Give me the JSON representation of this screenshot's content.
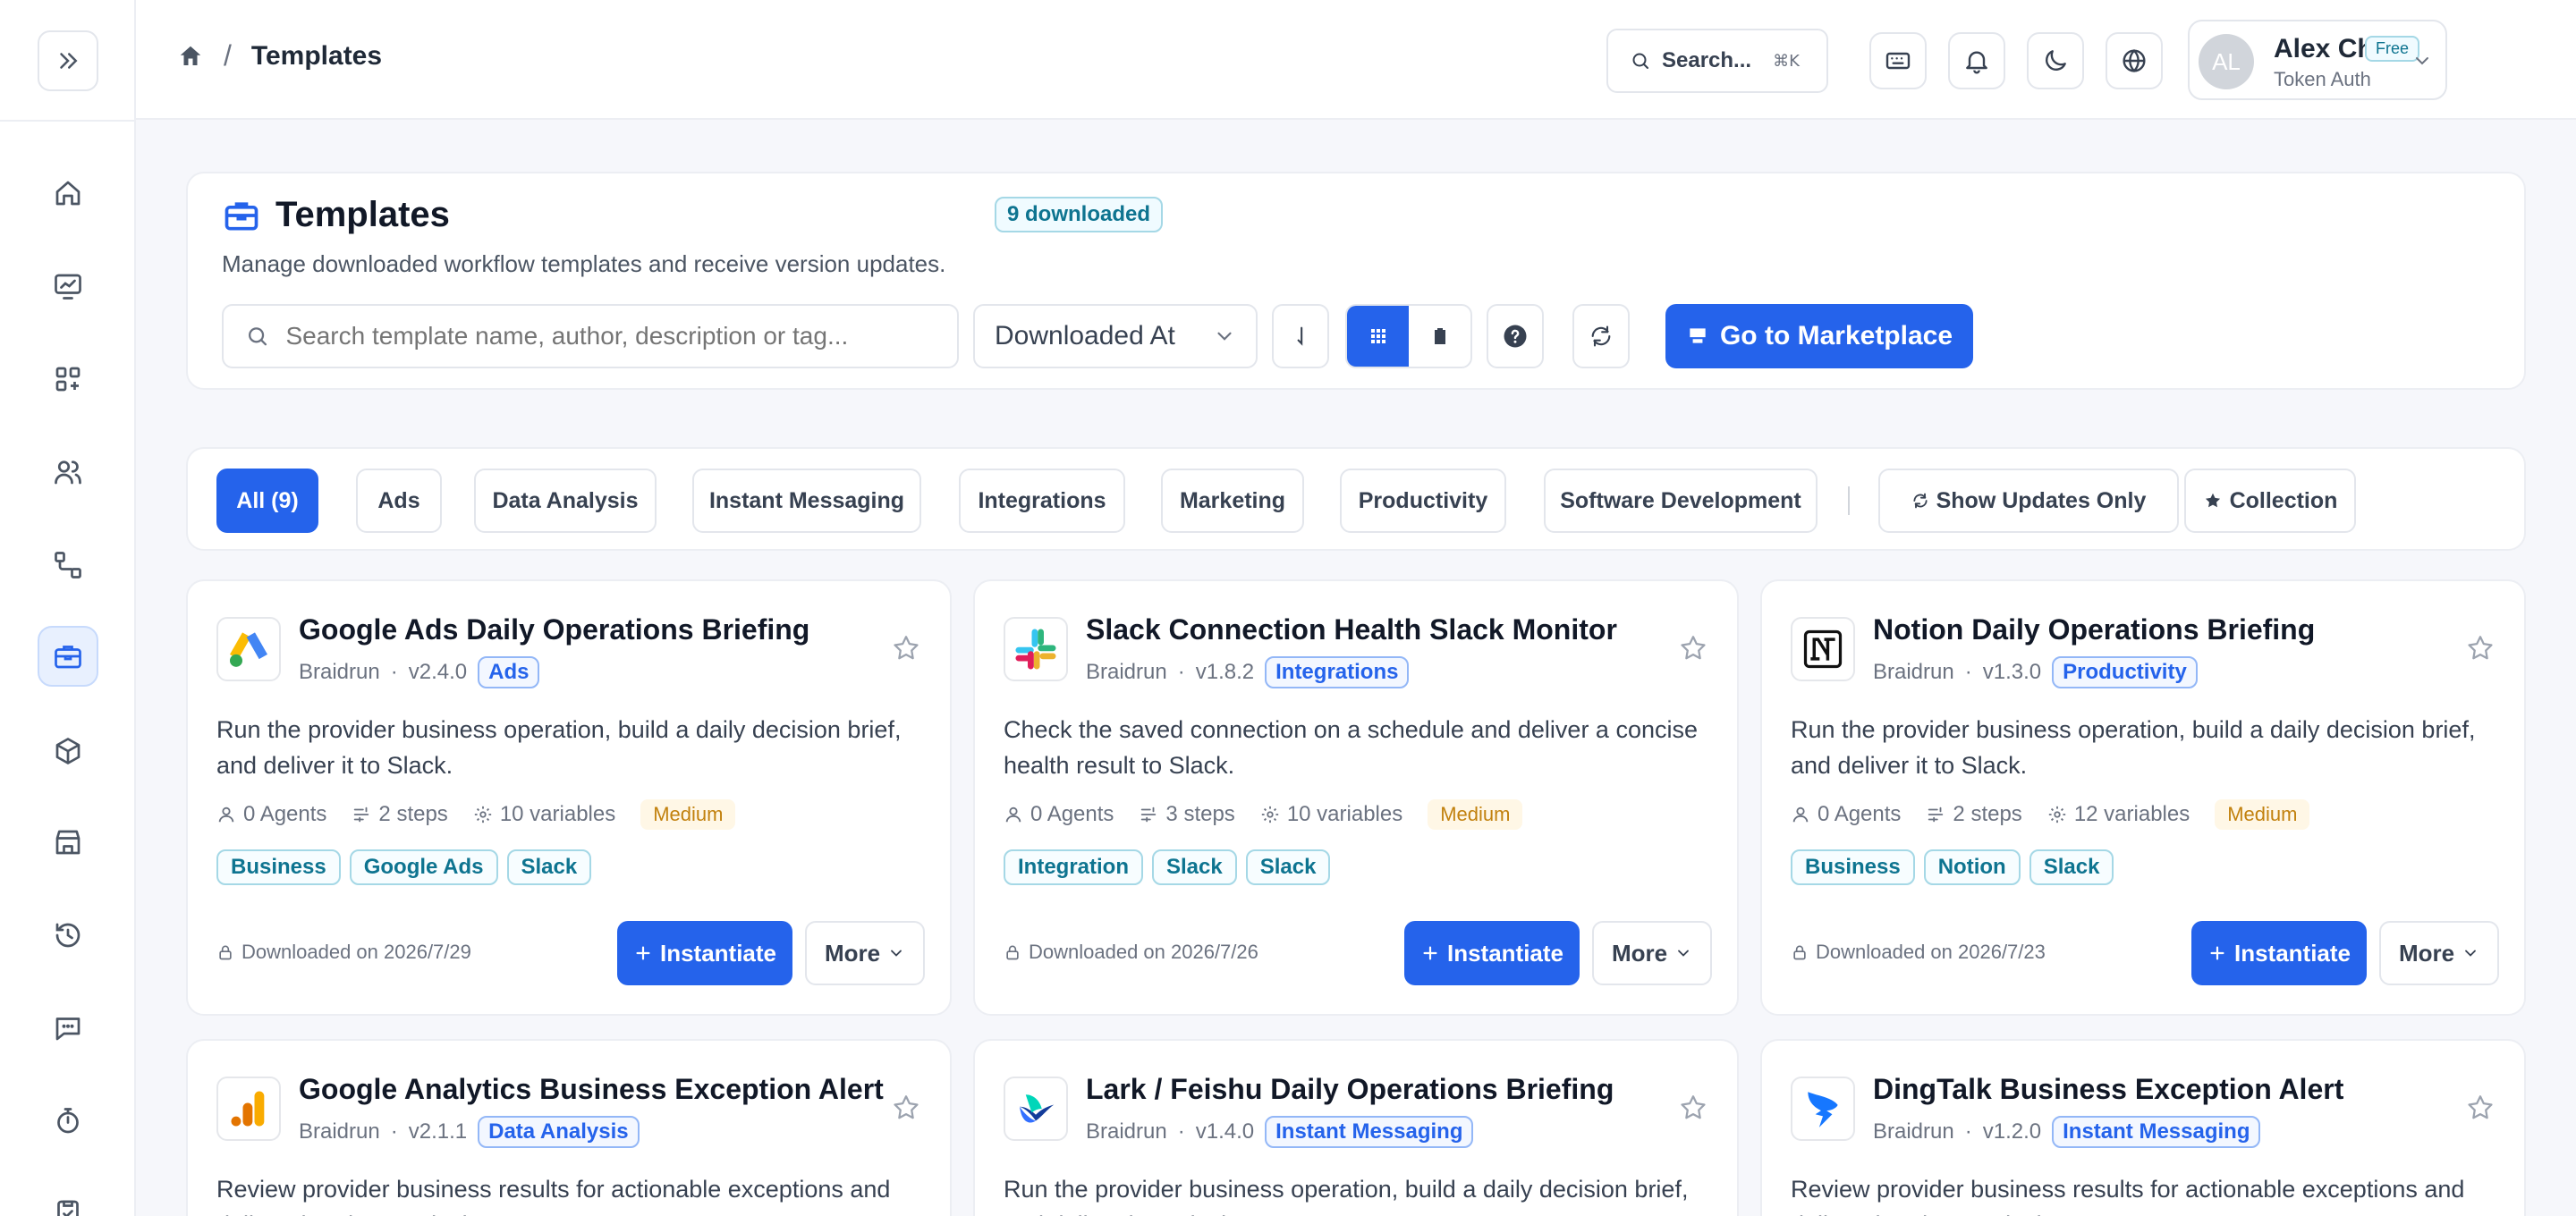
{
  "topbar": {
    "breadcrumb_title": "Templates",
    "breadcrumb_sep": "/",
    "search_label": "Search...",
    "search_shortcut": "⌘K"
  },
  "user": {
    "initials": "AL",
    "name": "Alex Chen",
    "plan": "Free",
    "auth": "Token Auth"
  },
  "header": {
    "title": "Templates",
    "badge": "9 downloaded",
    "description": "Manage downloaded workflow templates and receive version updates.",
    "search_placeholder": "Search template name, author, description or tag...",
    "sort_value": "Downloaded At",
    "marketplace_label": "Go to Marketplace"
  },
  "filters": {
    "chips": [
      "All (9)",
      "Ads",
      "Data Analysis",
      "Instant Messaging",
      "Integrations",
      "Marketing",
      "Productivity",
      "Software Development"
    ],
    "active": "All (9)",
    "show_updates": "Show Updates Only",
    "collection": "Collection"
  },
  "colors": {
    "accent": "#2563eb",
    "tag_cyan": "#0e7490",
    "level_amber": "#c2810e"
  },
  "cards": [
    {
      "title": "Google Ads Daily Operations Briefing",
      "author": "Braidrun",
      "version": "v2.4.0",
      "category": "Ads",
      "icon": "google-ads-icon",
      "description": "Run the provider business operation, build a daily decision brief, and deliver it to Slack.",
      "agents": "0 Agents",
      "steps": "2 steps",
      "variables": "10 variables",
      "level": "Medium",
      "tags": [
        "Business",
        "Google Ads",
        "Slack"
      ],
      "downloaded": "Downloaded on 2026/7/29",
      "instantiate": "Instantiate",
      "more": "More"
    },
    {
      "title": "Slack Connection Health Slack Monitor",
      "author": "Braidrun",
      "version": "v1.8.2",
      "category": "Integrations",
      "icon": "slack-icon",
      "description": "Check the saved connection on a schedule and deliver a concise health result to Slack.",
      "agents": "0 Agents",
      "steps": "3 steps",
      "variables": "10 variables",
      "level": "Medium",
      "tags": [
        "Integration",
        "Slack",
        "Slack"
      ],
      "downloaded": "Downloaded on 2026/7/26",
      "instantiate": "Instantiate",
      "more": "More"
    },
    {
      "title": "Notion Daily Operations Briefing",
      "author": "Braidrun",
      "version": "v1.3.0",
      "category": "Productivity",
      "icon": "notion-icon",
      "description": "Run the provider business operation, build a daily decision brief, and deliver it to Slack.",
      "agents": "0 Agents",
      "steps": "2 steps",
      "variables": "12 variables",
      "level": "Medium",
      "tags": [
        "Business",
        "Notion",
        "Slack"
      ],
      "downloaded": "Downloaded on 2026/7/23",
      "instantiate": "Instantiate",
      "more": "More"
    },
    {
      "title": "Google Analytics Business Exception Alert",
      "author": "Braidrun",
      "version": "v2.1.1",
      "category": "Data Analysis",
      "icon": "google-analytics-icon",
      "description": "Review provider business results for actionable exceptions and deliver the alert to Slack."
    },
    {
      "title": "Lark / Feishu Daily Operations Briefing",
      "author": "Braidrun",
      "version": "v1.4.0",
      "category": "Instant Messaging",
      "icon": "lark-icon",
      "description": "Run the provider business operation, build a daily decision brief, and deliver it to Slack."
    },
    {
      "title": "DingTalk Business Exception Alert",
      "author": "Braidrun",
      "version": "v1.2.0",
      "category": "Instant Messaging",
      "icon": "dingtalk-icon",
      "description": "Review provider business results for actionable exceptions and deliver the alert to Slack."
    }
  ]
}
